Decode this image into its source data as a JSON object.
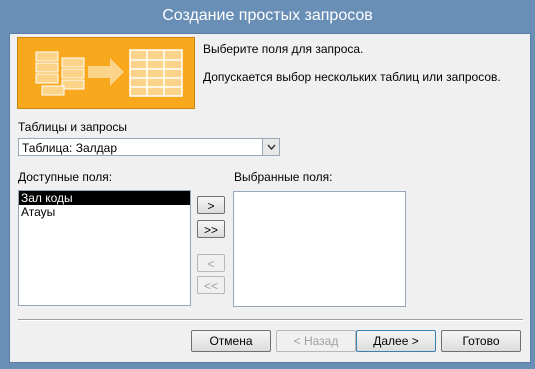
{
  "window": {
    "title": "Создание простых запросов"
  },
  "intro": {
    "line1": "Выберите поля для запроса.",
    "line2": "Допускается выбор нескольких таблиц или запросов."
  },
  "tables": {
    "label": "Таблицы и запросы",
    "selected": "Таблица: Залдар"
  },
  "available": {
    "label": "Доступные поля:",
    "items": [
      "Зал коды",
      "Атауы"
    ],
    "selected_index": 0
  },
  "selected_fields": {
    "label": "Выбранные поля:",
    "items": []
  },
  "move_buttons": {
    "add_one": ">",
    "add_all": ">>",
    "remove_one": "<",
    "remove_all": "<<"
  },
  "footer": {
    "cancel": "Отмена",
    "back": "< Назад",
    "next": "Далее >",
    "finish": "Готово"
  },
  "colors": {
    "title_bar": "#6a8fb7",
    "banner": "#f8a81c",
    "selection": "#000000"
  }
}
